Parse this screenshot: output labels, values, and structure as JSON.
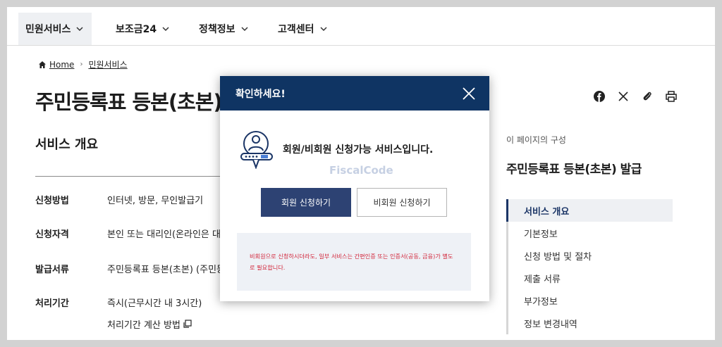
{
  "nav": {
    "items": [
      {
        "label": "민원서비스"
      },
      {
        "label": "보조금24"
      },
      {
        "label": "정책정보"
      },
      {
        "label": "고객센터"
      }
    ]
  },
  "breadcrumb": {
    "home": "Home",
    "current": "민원서비스"
  },
  "page": {
    "title": "주민등록표 등본(초본) 발급"
  },
  "overview": {
    "title": "서비스 개요",
    "rows": [
      {
        "label": "신청방법",
        "value": "인터넷, 방문, 무인발급기"
      },
      {
        "label": "신청자격",
        "value": "본인 또는 대리인(온라인은 대리"
      },
      {
        "label": "발급서류",
        "value": "주민등록표 등본(초본) (주민등"
      },
      {
        "label": "처리기간",
        "value": "즉시(근무시간 내 3시간)"
      }
    ],
    "calc_link": "처리기간 계산 방법"
  },
  "toc": {
    "heading": "이 페이지의 구성",
    "title": "주민등록표 등본(초본) 발급",
    "items": [
      {
        "label": "서비스 개요"
      },
      {
        "label": "기본정보"
      },
      {
        "label": "신청 방법 및 절차"
      },
      {
        "label": "제출 서류"
      },
      {
        "label": "부가정보"
      },
      {
        "label": "정보 변경내역"
      }
    ]
  },
  "modal": {
    "title": "확인하세요!",
    "message": "회원/비회원 신청가능 서비스입니다.",
    "watermark": "FiscalCode",
    "member_button": "회원 신청하기",
    "guest_button": "비회원 신청하기",
    "notice": "비회원으로 신청하시더라도, 일부 서비스는 간편인증 또는 인증서(공동, 금융)가 별도로 필요합니다."
  },
  "colors": {
    "header_navy": "#0f3463",
    "primary_button": "#2d4273",
    "notice_text": "#d2263b",
    "toc_active": "#1b3566"
  }
}
